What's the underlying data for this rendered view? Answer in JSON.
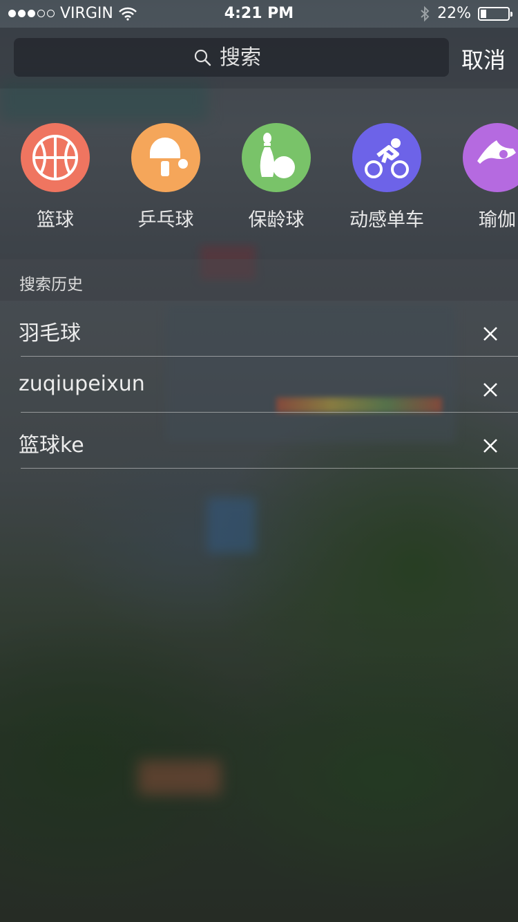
{
  "status_bar": {
    "carrier": "VIRGIN",
    "time": "4:21 PM",
    "battery": "22%",
    "battery_level": 0.22
  },
  "search": {
    "placeholder": "搜索",
    "cancel_label": "取消"
  },
  "categories": [
    {
      "label": "篮球",
      "color": "#ef7560",
      "icon": "basketball-icon"
    },
    {
      "label": "乒乓球",
      "color": "#f5a65a",
      "icon": "ping-pong-icon"
    },
    {
      "label": "保龄球",
      "color": "#79c369",
      "icon": "bowling-icon"
    },
    {
      "label": "动感单车",
      "color": "#6d63e8",
      "icon": "cycling-icon"
    },
    {
      "label": "瑜伽",
      "color": "#b56ae0",
      "icon": "yoga-icon"
    }
  ],
  "history": {
    "title": "搜索历史",
    "items": [
      "羽毛球",
      "zuqiupeixun",
      "篮球ke"
    ]
  }
}
